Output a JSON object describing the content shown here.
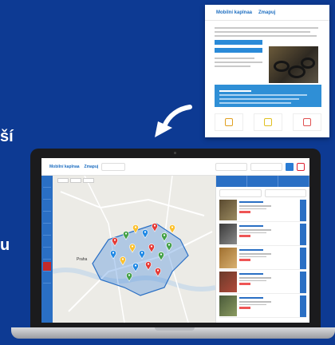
{
  "edge_text": {
    "line1": "ší",
    "line2": "u"
  },
  "email_preview": {
    "logo": "Mobilní kaplnaa",
    "logo2": "Zmapuj"
  },
  "app": {
    "brand": "Mobilní kaplnaa",
    "brand2": "Zmapuj"
  },
  "map": {
    "city_label": "Praha",
    "pins": [
      {
        "color": "#e53935"
      },
      {
        "color": "#43a047"
      },
      {
        "color": "#fbc02d"
      },
      {
        "color": "#1e88e5"
      },
      {
        "color": "#e53935"
      },
      {
        "color": "#43a047"
      },
      {
        "color": "#fbc02d"
      },
      {
        "color": "#1e88e5"
      },
      {
        "color": "#e53935"
      },
      {
        "color": "#43a047"
      },
      {
        "color": "#fbc02d"
      },
      {
        "color": "#1e88e5"
      },
      {
        "color": "#e53935"
      },
      {
        "color": "#43a047"
      },
      {
        "color": "#1e88e5"
      },
      {
        "color": "#fbc02d"
      },
      {
        "color": "#e53935"
      },
      {
        "color": "#43a047"
      }
    ]
  },
  "colors": {
    "background": "#0d3a93",
    "accent": "#2a6fc4",
    "alert": "#c22a2a"
  }
}
